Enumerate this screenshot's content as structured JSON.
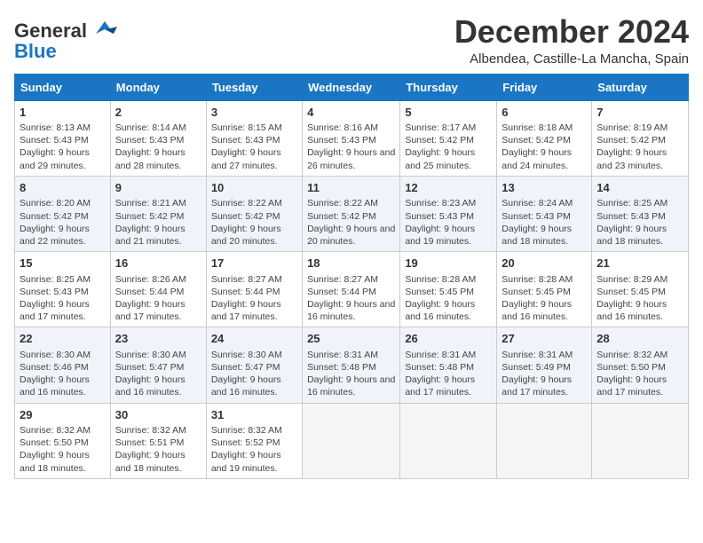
{
  "logo": {
    "general": "General",
    "blue": "Blue"
  },
  "header": {
    "month_year": "December 2024",
    "location": "Albendea, Castille-La Mancha, Spain"
  },
  "weekdays": [
    "Sunday",
    "Monday",
    "Tuesday",
    "Wednesday",
    "Thursday",
    "Friday",
    "Saturday"
  ],
  "weeks": [
    [
      {
        "day": "1",
        "sunrise": "8:13 AM",
        "sunset": "5:43 PM",
        "daylight": "9 hours and 29 minutes."
      },
      {
        "day": "2",
        "sunrise": "8:14 AM",
        "sunset": "5:43 PM",
        "daylight": "9 hours and 28 minutes."
      },
      {
        "day": "3",
        "sunrise": "8:15 AM",
        "sunset": "5:43 PM",
        "daylight": "9 hours and 27 minutes."
      },
      {
        "day": "4",
        "sunrise": "8:16 AM",
        "sunset": "5:43 PM",
        "daylight": "9 hours and 26 minutes."
      },
      {
        "day": "5",
        "sunrise": "8:17 AM",
        "sunset": "5:42 PM",
        "daylight": "9 hours and 25 minutes."
      },
      {
        "day": "6",
        "sunrise": "8:18 AM",
        "sunset": "5:42 PM",
        "daylight": "9 hours and 24 minutes."
      },
      {
        "day": "7",
        "sunrise": "8:19 AM",
        "sunset": "5:42 PM",
        "daylight": "9 hours and 23 minutes."
      }
    ],
    [
      {
        "day": "8",
        "sunrise": "8:20 AM",
        "sunset": "5:42 PM",
        "daylight": "9 hours and 22 minutes."
      },
      {
        "day": "9",
        "sunrise": "8:21 AM",
        "sunset": "5:42 PM",
        "daylight": "9 hours and 21 minutes."
      },
      {
        "day": "10",
        "sunrise": "8:22 AM",
        "sunset": "5:42 PM",
        "daylight": "9 hours and 20 minutes."
      },
      {
        "day": "11",
        "sunrise": "8:22 AM",
        "sunset": "5:42 PM",
        "daylight": "9 hours and 20 minutes."
      },
      {
        "day": "12",
        "sunrise": "8:23 AM",
        "sunset": "5:43 PM",
        "daylight": "9 hours and 19 minutes."
      },
      {
        "day": "13",
        "sunrise": "8:24 AM",
        "sunset": "5:43 PM",
        "daylight": "9 hours and 18 minutes."
      },
      {
        "day": "14",
        "sunrise": "8:25 AM",
        "sunset": "5:43 PM",
        "daylight": "9 hours and 18 minutes."
      }
    ],
    [
      {
        "day": "15",
        "sunrise": "8:25 AM",
        "sunset": "5:43 PM",
        "daylight": "9 hours and 17 minutes."
      },
      {
        "day": "16",
        "sunrise": "8:26 AM",
        "sunset": "5:44 PM",
        "daylight": "9 hours and 17 minutes."
      },
      {
        "day": "17",
        "sunrise": "8:27 AM",
        "sunset": "5:44 PM",
        "daylight": "9 hours and 17 minutes."
      },
      {
        "day": "18",
        "sunrise": "8:27 AM",
        "sunset": "5:44 PM",
        "daylight": "9 hours and 16 minutes."
      },
      {
        "day": "19",
        "sunrise": "8:28 AM",
        "sunset": "5:45 PM",
        "daylight": "9 hours and 16 minutes."
      },
      {
        "day": "20",
        "sunrise": "8:28 AM",
        "sunset": "5:45 PM",
        "daylight": "9 hours and 16 minutes."
      },
      {
        "day": "21",
        "sunrise": "8:29 AM",
        "sunset": "5:45 PM",
        "daylight": "9 hours and 16 minutes."
      }
    ],
    [
      {
        "day": "22",
        "sunrise": "8:30 AM",
        "sunset": "5:46 PM",
        "daylight": "9 hours and 16 minutes."
      },
      {
        "day": "23",
        "sunrise": "8:30 AM",
        "sunset": "5:47 PM",
        "daylight": "9 hours and 16 minutes."
      },
      {
        "day": "24",
        "sunrise": "8:30 AM",
        "sunset": "5:47 PM",
        "daylight": "9 hours and 16 minutes."
      },
      {
        "day": "25",
        "sunrise": "8:31 AM",
        "sunset": "5:48 PM",
        "daylight": "9 hours and 16 minutes."
      },
      {
        "day": "26",
        "sunrise": "8:31 AM",
        "sunset": "5:48 PM",
        "daylight": "9 hours and 17 minutes."
      },
      {
        "day": "27",
        "sunrise": "8:31 AM",
        "sunset": "5:49 PM",
        "daylight": "9 hours and 17 minutes."
      },
      {
        "day": "28",
        "sunrise": "8:32 AM",
        "sunset": "5:50 PM",
        "daylight": "9 hours and 17 minutes."
      }
    ],
    [
      {
        "day": "29",
        "sunrise": "8:32 AM",
        "sunset": "5:50 PM",
        "daylight": "9 hours and 18 minutes."
      },
      {
        "day": "30",
        "sunrise": "8:32 AM",
        "sunset": "5:51 PM",
        "daylight": "9 hours and 18 minutes."
      },
      {
        "day": "31",
        "sunrise": "8:32 AM",
        "sunset": "5:52 PM",
        "daylight": "9 hours and 19 minutes."
      },
      null,
      null,
      null,
      null
    ]
  ]
}
